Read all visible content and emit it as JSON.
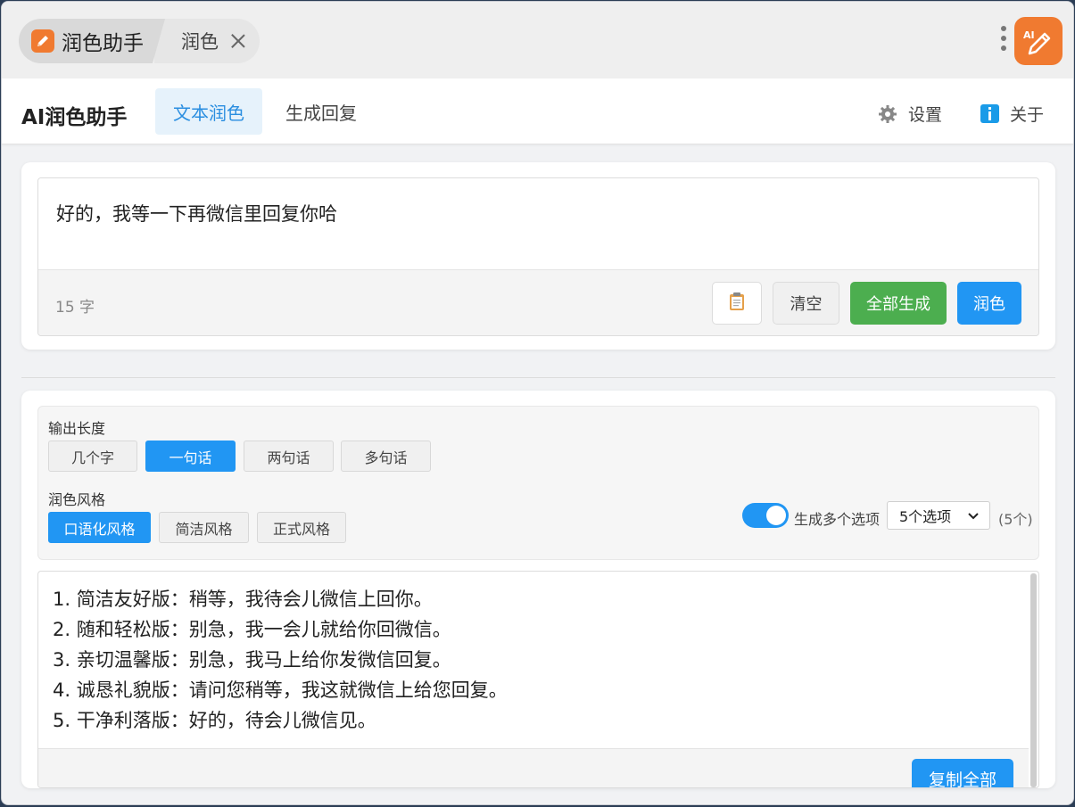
{
  "titlebar": {
    "main_tab_label": "润色助手",
    "sub_tab_label": "润色",
    "app_logo_text": "AI"
  },
  "header": {
    "app_title": "AI润色助手",
    "tabs": [
      {
        "label": "文本润色",
        "active": true
      },
      {
        "label": "生成回复",
        "active": false
      }
    ],
    "settings_label": "设置",
    "about_label": "关于"
  },
  "input": {
    "text": "好的，我等一下再微信里回复你哈",
    "char_count": "15 字",
    "clear_label": "清空",
    "generate_all_label": "全部生成",
    "polish_label": "润色"
  },
  "options": {
    "length_label": "输出长度",
    "length_options": [
      {
        "label": "几个字",
        "active": false
      },
      {
        "label": "一句话",
        "active": true
      },
      {
        "label": "两句话",
        "active": false
      },
      {
        "label": "多句话",
        "active": false
      }
    ],
    "style_label": "润色风格",
    "style_options": [
      {
        "label": "口语化风格",
        "active": true
      },
      {
        "label": "简洁风格",
        "active": false
      },
      {
        "label": "正式风格",
        "active": false
      }
    ],
    "multi_toggle_label": "生成多个选项",
    "multi_toggle_on": true,
    "count_select_value": "5个选项",
    "count_note": "(5个)"
  },
  "results": {
    "items": [
      "1. 简洁友好版：稍等，我待会儿微信上回你。",
      "2. 随和轻松版：别急，我一会儿就给你回微信。",
      "3. 亲切温馨版：别急，我马上给你发微信回复。",
      "4. 诚恳礼貌版：请问您稍等，我这就微信上给您回复。",
      "5. 干净利落版：好的，待会儿微信见。"
    ],
    "copy_all_label": "复制全部"
  },
  "colors": {
    "accent_blue": "#2196f3",
    "green": "#4cae4f",
    "logo_orange": "#f07a30"
  }
}
